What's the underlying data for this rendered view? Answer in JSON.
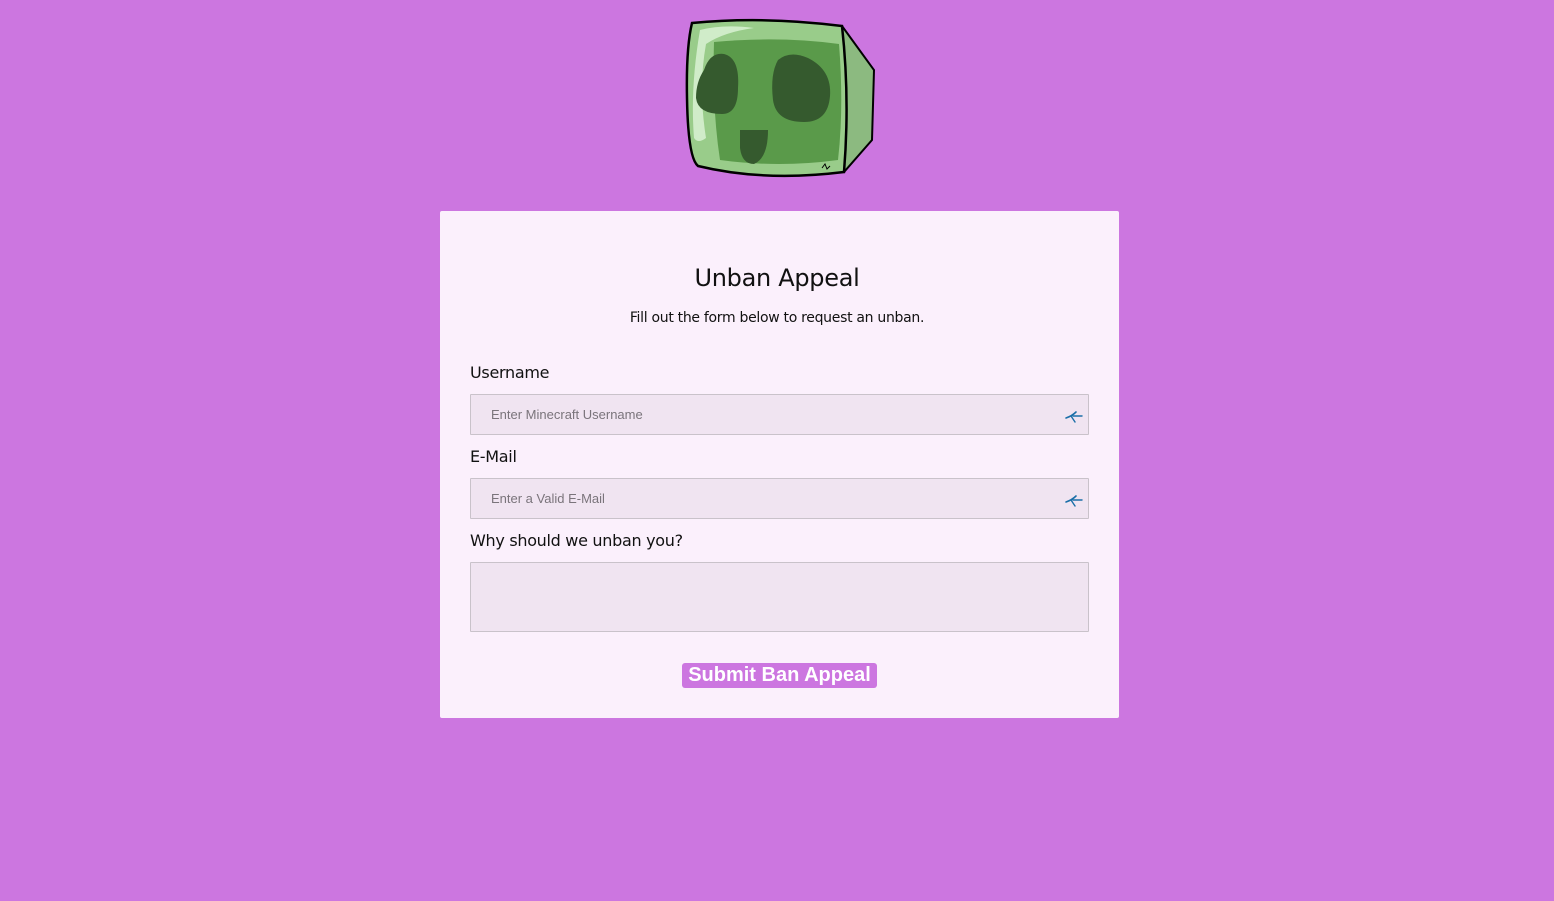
{
  "header": {
    "logo_icon": "slime-logo-icon"
  },
  "form": {
    "title": "Unban Appeal",
    "subtitle": "Fill out the form below to request an unban.",
    "username": {
      "label": "Username",
      "placeholder": "Enter Minecraft Username",
      "value": ""
    },
    "email": {
      "label": "E-Mail",
      "placeholder": "Enter a Valid E-Mail",
      "value": ""
    },
    "reason": {
      "label": "Why should we unban you?",
      "value": ""
    },
    "submit_label": "Submit Ban Appeal"
  },
  "colors": {
    "background": "#cc76e0",
    "card": "#fbf0fc",
    "field": "#f0e4f1",
    "button": "#cc76e0"
  }
}
